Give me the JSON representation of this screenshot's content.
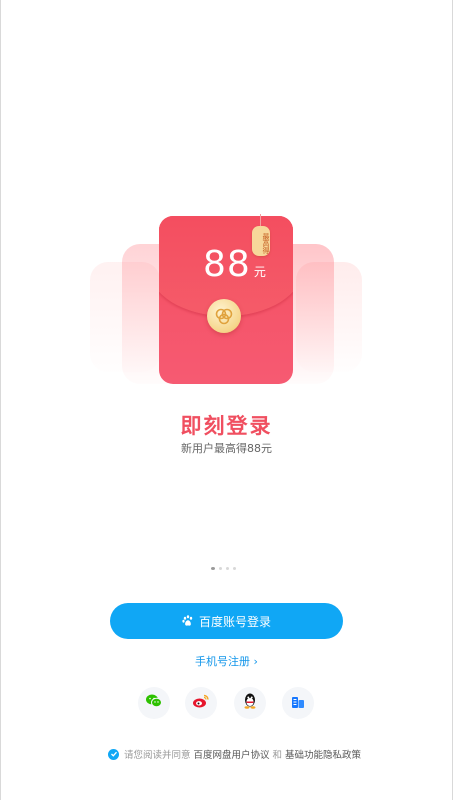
{
  "promo": {
    "amount": "88",
    "unit": "元",
    "tag_text": "最高得",
    "title": "即刻登录",
    "subtitle": "新用户最高得88元"
  },
  "carousel": {
    "dots": 4,
    "active": 0
  },
  "login": {
    "baidu_button": "百度账号登录",
    "register_link": "手机号注册 ›"
  },
  "social": [
    {
      "name": "wechat-icon",
      "color": "#2dc100"
    },
    {
      "name": "weibo-icon",
      "color": "#e6162d"
    },
    {
      "name": "qq-icon",
      "color": "#111111"
    },
    {
      "name": "enterprise-icon",
      "color": "#1677ff"
    }
  ],
  "agreement": {
    "prefix": "请您阅读并同意",
    "user_agreement": "百度网盘用户协议",
    "conjunction": "和",
    "privacy_policy": "基础功能隐私政策"
  },
  "colors": {
    "primary": "#10a7f5",
    "envelope": "#f14a56",
    "title": "#f04f60"
  }
}
